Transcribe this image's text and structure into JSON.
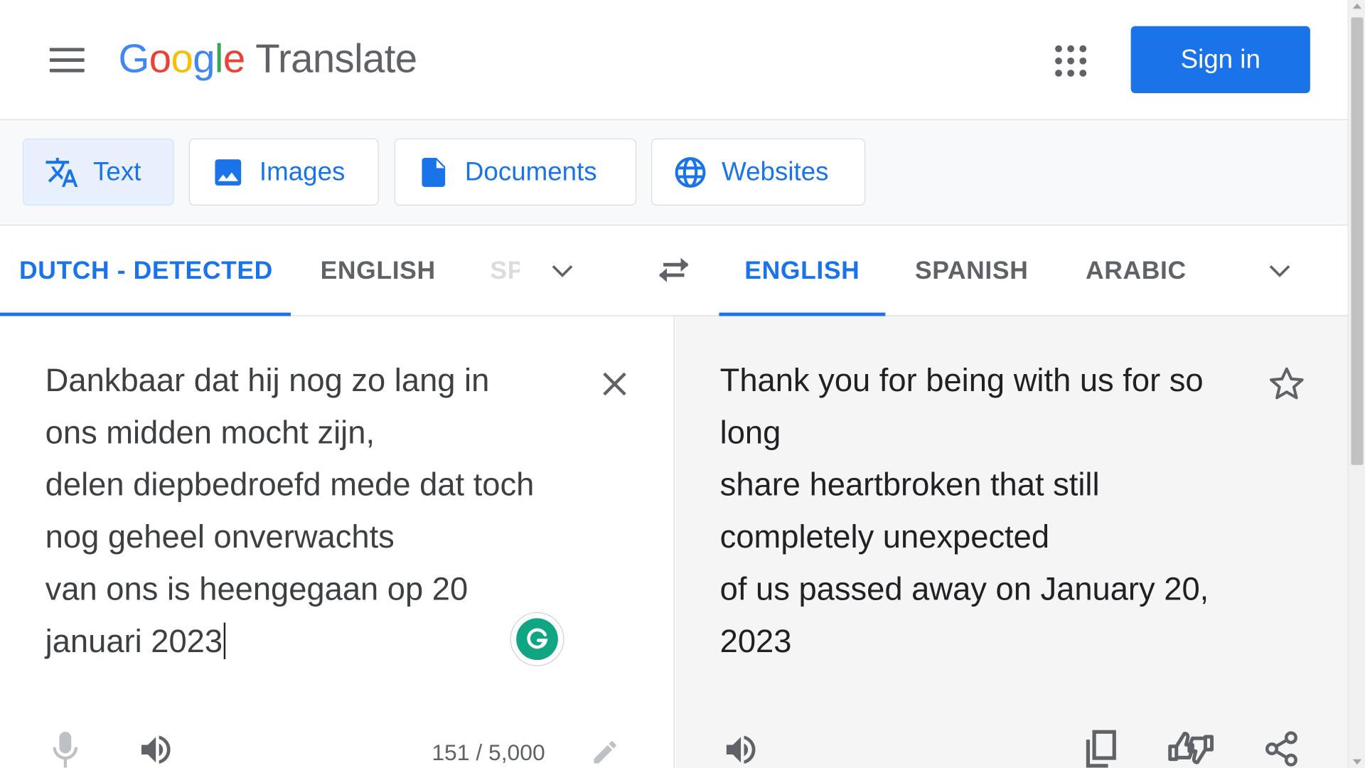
{
  "header": {
    "logo_letters": [
      "G",
      "o",
      "o",
      "g",
      "l",
      "e"
    ],
    "product": "Translate",
    "sign_in": "Sign in"
  },
  "modes": [
    {
      "label": "Text",
      "icon": "translate-icon",
      "active": true
    },
    {
      "label": "Images",
      "icon": "image-icon",
      "active": false
    },
    {
      "label": "Documents",
      "icon": "document-icon",
      "active": false
    },
    {
      "label": "Websites",
      "icon": "globe-icon",
      "active": false
    }
  ],
  "source_langs": {
    "detected": "DUTCH - DETECTED",
    "second": "ENGLISH",
    "third_truncated": "SPANISH"
  },
  "target_langs": {
    "first": "ENGLISH",
    "second": "SPANISH",
    "third": "ARABIC"
  },
  "source": {
    "lines": [
      "Dankbaar dat hij nog zo lang in",
      "ons midden mocht zijn,",
      "delen diepbedroefd mede dat toch",
      "nog geheel onverwachts",
      "van ons is heengegaan op 20",
      "januari 2023"
    ],
    "char_count": "151 / 5,000"
  },
  "target": {
    "lines": [
      "Thank you for being with us for so",
      "long",
      "share heartbroken that still",
      "completely unexpected",
      "of us passed away on January 20,",
      "2023"
    ]
  },
  "colors": {
    "accent": "#1a73e8",
    "grammarly": "#11a683"
  }
}
